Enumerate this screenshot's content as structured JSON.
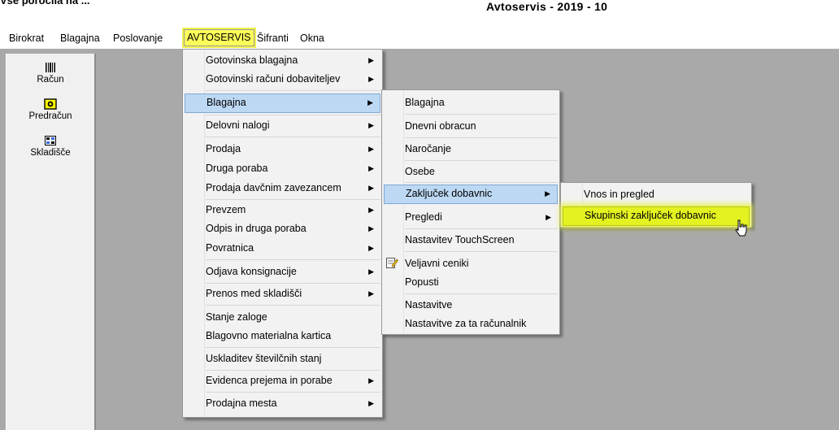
{
  "window": {
    "title": "Avtoservis - 2019 - 10",
    "clipped_top_text": "Vse poročila na ..."
  },
  "menubar": {
    "items": [
      "Birokrat",
      "Blagajna",
      "Poslovanje",
      "AVTOSERVIS",
      "Šifranti",
      "Okna"
    ],
    "active": "AVTOSERVIS"
  },
  "toolpanel": {
    "items": [
      {
        "label": "Račun",
        "icon": "barcode-icon"
      },
      {
        "label": "Predračun",
        "icon": "camera-icon"
      },
      {
        "label": "Skladišče",
        "icon": "warehouse-icon"
      }
    ]
  },
  "menu_avtoservis": {
    "items": [
      "Gotovinska blagajna",
      "Gotovinski računi dobaviteljev",
      "Blagajna",
      "Delovni nalogi",
      "Prodaja",
      "Druga poraba",
      "Prodaja davčnim zavezancem",
      "Prevzem",
      "Odpis in druga poraba",
      "Povratnica",
      "Odjava konsignacije",
      "Prenos med skladišči",
      "Stanje zaloge",
      "Blagovno materialna kartica",
      "Uskladitev številčnih stanj",
      "Evidenca prejema in porabe",
      "Prodajna mesta"
    ],
    "highlighted": "Blagajna"
  },
  "menu_blagajna": {
    "items": [
      "Blagajna",
      "Dnevni obracun",
      "Naročanje",
      "Osebe",
      "Zaključek dobavnic",
      "Pregledi",
      "Nastavitev TouchScreen",
      "Veljavni ceniki",
      "Popusti",
      "Nastavitve",
      "Nastavitve za ta računalnik"
    ],
    "highlighted": "Zaključek dobavnic"
  },
  "menu_zakljucek": {
    "items": [
      "Vnos in pregled",
      "Skupinski zaključek dobavnic"
    ],
    "highlighted": "Skupinski zaključek dobavnic",
    "highlight_color": "#e3f220"
  },
  "colors": {
    "workspace": "#a9a9a9",
    "menu_highlight": "#bcd8f3",
    "menubar_active": "#ffff5a"
  }
}
